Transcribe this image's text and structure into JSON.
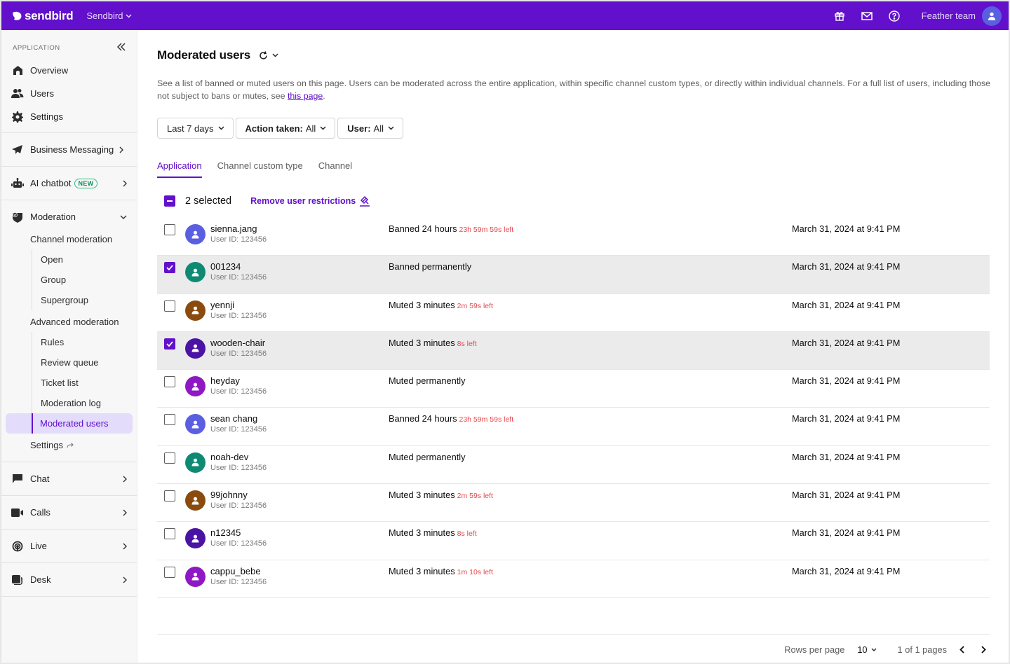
{
  "topbar": {
    "brand": "sendbird",
    "org": "Sendbird",
    "team": "Feather team",
    "icons": [
      "gift-icon",
      "mail-icon",
      "help-icon"
    ],
    "accent": "#6210cc"
  },
  "sidebar": {
    "section_label": "APPLICATION",
    "top_items": [
      {
        "label": "Overview",
        "icon": "home-icon"
      },
      {
        "label": "Users",
        "icon": "users-icon"
      },
      {
        "label": "Settings",
        "icon": "gear-icon"
      }
    ],
    "business_messaging": "Business Messaging",
    "ai_chatbot": "AI chatbot",
    "new_badge": "NEW",
    "moderation": {
      "label": "Moderation",
      "channel_moderation": "Channel moderation",
      "channel_items": [
        "Open",
        "Group",
        "Supergroup"
      ],
      "advanced_moderation": "Advanced moderation",
      "advanced_items": [
        "Rules",
        "Review queue",
        "Ticket list",
        "Moderation log"
      ],
      "active_item": "Moderated users",
      "settings": "Settings"
    },
    "bottom_items": [
      {
        "label": "Chat",
        "icon": "chat-icon"
      },
      {
        "label": "Calls",
        "icon": "video-icon"
      },
      {
        "label": "Live",
        "icon": "broadcast-icon"
      },
      {
        "label": "Desk",
        "icon": "desk-icon"
      }
    ]
  },
  "page": {
    "title": "Moderated users",
    "description_1": "See a list of banned or muted users on this page. Users can be moderated across the entire application, within specific channel custom types, or directly within individual channels. For a full list of users, including those not subject to bans or mutes, see ",
    "link_text": "this page",
    "description_end": ".",
    "filters": {
      "date": "Last 7 days",
      "action_label": "Action taken:",
      "action_value": "All",
      "user_label": "User:",
      "user_value": "All"
    },
    "tabs": [
      "Application",
      "Channel custom type",
      "Channel"
    ],
    "active_tab": "Application",
    "bulk": {
      "selected": "2 selected",
      "remove": "Remove user restrictions"
    }
  },
  "rows": [
    {
      "name": "sienna.jang",
      "uid": "User ID: 123456",
      "action": "Banned 24 hours",
      "remaining": "23h 59m 59s left",
      "date": "March 31, 2024 at 9:41 PM",
      "selected": false,
      "color": "#5a5ee0"
    },
    {
      "name": "001234",
      "uid": "User ID: 123456",
      "action": "Banned permanently",
      "remaining": "",
      "date": "March 31, 2024 at 9:41 PM",
      "selected": true,
      "color": "#0f8a72"
    },
    {
      "name": "yennji",
      "uid": "User ID: 123456",
      "action": "Muted 3 minutes",
      "remaining": "2m 59s left",
      "date": "March 31, 2024 at 9:41 PM",
      "selected": false,
      "color": "#8a4b0e"
    },
    {
      "name": "wooden-chair",
      "uid": "User ID: 123456",
      "action": "Muted 3 minutes",
      "remaining": "8s left",
      "date": "March 31, 2024 at 9:41 PM",
      "selected": true,
      "color": "#4a13a3"
    },
    {
      "name": "heyday",
      "uid": "User ID: 123456",
      "action": "Muted permanently",
      "remaining": "",
      "date": "March 31, 2024 at 9:41 PM",
      "selected": false,
      "color": "#8f18c4"
    },
    {
      "name": "sean chang",
      "uid": "User ID: 123456",
      "action": "Banned 24 hours",
      "remaining": "23h 59m 59s left",
      "date": "March 31, 2024 at 9:41 PM",
      "selected": false,
      "color": "#5a5ee0"
    },
    {
      "name": "noah-dev",
      "uid": "User ID: 123456",
      "action": "Muted permanently",
      "remaining": "",
      "date": "March 31, 2024 at 9:41 PM",
      "selected": false,
      "color": "#0f8a72"
    },
    {
      "name": "99johnny",
      "uid": "User ID: 123456",
      "action": "Muted 3 minutes",
      "remaining": "2m 59s left",
      "date": "March 31, 2024 at 9:41 PM",
      "selected": false,
      "color": "#8a4b0e"
    },
    {
      "name": "n12345",
      "uid": "User ID: 123456",
      "action": "Muted 3 minutes",
      "remaining": "8s left",
      "date": "March 31, 2024 at 9:41 PM",
      "selected": false,
      "color": "#4a13a3"
    },
    {
      "name": "cappu_bebe",
      "uid": "User ID: 123456",
      "action": "Muted 3 minutes",
      "remaining": "1m 10s left",
      "date": "March 31, 2024 at 9:41 PM",
      "selected": false,
      "color": "#8f18c4"
    }
  ],
  "pagination": {
    "rows_per_page_label": "Rows per page",
    "rows_per_page": "10",
    "pages": "1 of 1 pages"
  }
}
